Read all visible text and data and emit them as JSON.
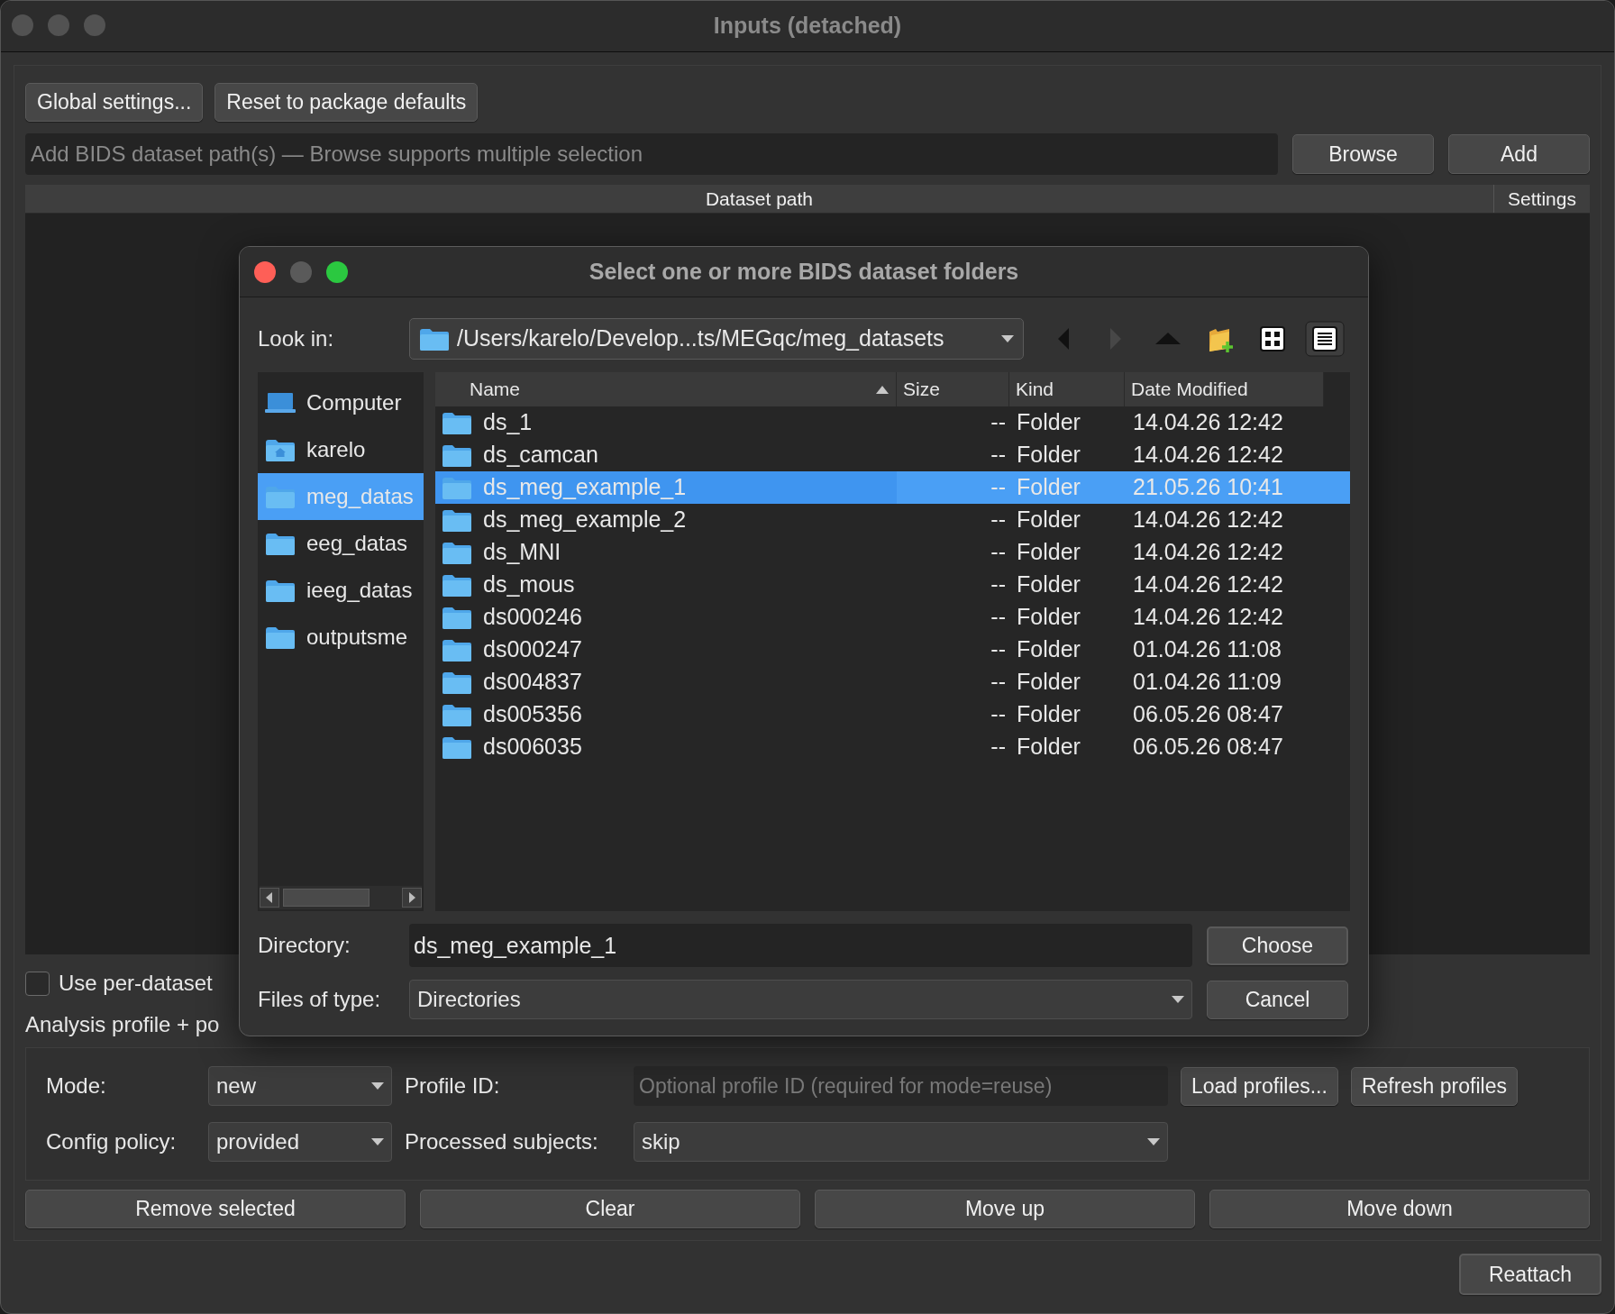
{
  "window": {
    "title": "Inputs (detached)"
  },
  "top_buttons": [
    "Global settings...",
    "Reset to package defaults"
  ],
  "path_input": {
    "placeholder": "Add BIDS dataset path(s) — Browse supports multiple selection",
    "buttons": [
      "Browse",
      "Add"
    ]
  },
  "dataset_table": {
    "columns": [
      "Dataset path",
      "Settings"
    ]
  },
  "per_dataset": {
    "label": "Use per-dataset",
    "checked": false
  },
  "analysis_profile": {
    "label": "Analysis profile + po",
    "mode": {
      "label": "Mode:",
      "value": "new"
    },
    "profile_id": {
      "label": "Profile ID:",
      "placeholder": "Optional profile ID (required for mode=reuse)"
    },
    "buttons": [
      "Load profiles...",
      "Refresh profiles"
    ],
    "config_policy": {
      "label": "Config policy:",
      "value": "provided"
    },
    "processed_subjects": {
      "label": "Processed subjects:",
      "value": "skip"
    }
  },
  "action_buttons": [
    "Remove selected",
    "Clear",
    "Move up",
    "Move down"
  ],
  "reattach_button": {
    "label": "Reattach",
    "default": true
  },
  "dialog": {
    "title": "Select one or more BIDS dataset folders",
    "look_in": {
      "label": "Look in:",
      "path": "/Users/karelo/Develop...ts/MEGqc/meg_datasets"
    },
    "nav": [
      {
        "kind": "back",
        "disabled": false
      },
      {
        "kind": "forward",
        "disabled": true
      },
      {
        "kind": "up",
        "disabled": false
      },
      {
        "kind": "new-folder"
      },
      {
        "kind": "icon-view",
        "selected": false
      },
      {
        "kind": "list-view",
        "selected": true
      }
    ],
    "sidebar": [
      {
        "label": "Computer",
        "kind": "computer",
        "selected": false
      },
      {
        "label": "karelo",
        "kind": "home",
        "selected": false
      },
      {
        "label": "meg_datas",
        "kind": "folder",
        "selected": true
      },
      {
        "label": "eeg_datas",
        "kind": "folder",
        "selected": false
      },
      {
        "label": "ieeg_datas",
        "kind": "folder",
        "selected": false
      },
      {
        "label": "outputsme",
        "kind": "folder",
        "selected": false
      }
    ],
    "files": {
      "columns": [
        {
          "label": "Name",
          "sorted": true
        },
        {
          "label": "Size",
          "sorted": false
        },
        {
          "label": "Kind",
          "sorted": false
        },
        {
          "label": "Date Modified",
          "sorted": false
        }
      ],
      "rows": [
        {
          "name": "ds_1",
          "size": "--",
          "kind": "Folder",
          "date": "14.04.26 12:42",
          "selected": false
        },
        {
          "name": "ds_camcan",
          "size": "--",
          "kind": "Folder",
          "date": "14.04.26 12:42",
          "selected": false
        },
        {
          "name": "ds_meg_example_1",
          "size": "--",
          "kind": "Folder",
          "date": "21.05.26 10:41",
          "selected": true
        },
        {
          "name": "ds_meg_example_2",
          "size": "--",
          "kind": "Folder",
          "date": "14.04.26 12:42",
          "selected": false
        },
        {
          "name": "ds_MNI",
          "size": "--",
          "kind": "Folder",
          "date": "14.04.26 12:42",
          "selected": false
        },
        {
          "name": "ds_mous",
          "size": "--",
          "kind": "Folder",
          "date": "14.04.26 12:42",
          "selected": false
        },
        {
          "name": "ds000246",
          "size": "--",
          "kind": "Folder",
          "date": "14.04.26 12:42",
          "selected": false
        },
        {
          "name": "ds000247",
          "size": "--",
          "kind": "Folder",
          "date": "01.04.26 11:08",
          "selected": false
        },
        {
          "name": "ds004837",
          "size": "--",
          "kind": "Folder",
          "date": "01.04.26 11:09",
          "selected": false
        },
        {
          "name": "ds005356",
          "size": "--",
          "kind": "Folder",
          "date": "06.05.26 08:47",
          "selected": false
        },
        {
          "name": "ds006035",
          "size": "--",
          "kind": "Folder",
          "date": "06.05.26 08:47",
          "selected": false
        }
      ]
    },
    "directory": {
      "label": "Directory:",
      "value": "ds_meg_example_1"
    },
    "file_type": {
      "label": "Files of type:",
      "value": "Directories"
    },
    "buttons": [
      {
        "label": "Choose",
        "default": true
      },
      {
        "label": "Cancel",
        "default": false
      }
    ]
  }
}
